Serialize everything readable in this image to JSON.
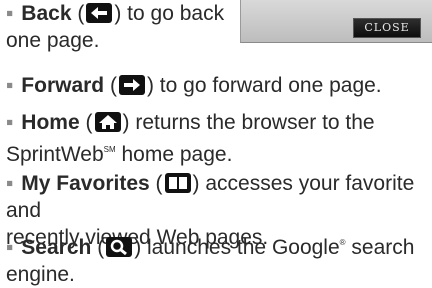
{
  "dialog": {
    "close_label": "CLOSE"
  },
  "items": [
    {
      "term": "Back",
      "icon": "back-arrow-icon",
      "line1": ") to go back",
      "line2": "one page."
    },
    {
      "term": "Forward",
      "icon": "forward-arrow-icon",
      "line1": ") to go forward one page."
    },
    {
      "term": "Home",
      "icon": "home-icon",
      "line1": ") returns the browser to the",
      "line2_pre": "SprintWeb",
      "line2_sup": "SM",
      "line2_post": " home page."
    },
    {
      "term": "My Favorites",
      "icon": "bookmark-book-icon",
      "line1": ") accesses your favorite and",
      "line2": "recently viewed Web pages."
    },
    {
      "term": "Search",
      "icon": "search-icon",
      "line1_pre": ") launches the Google",
      "line1_sup": "®",
      "line1_post": " search",
      "line2": "engine."
    }
  ],
  "open_paren": "(",
  "bullet": "▪"
}
